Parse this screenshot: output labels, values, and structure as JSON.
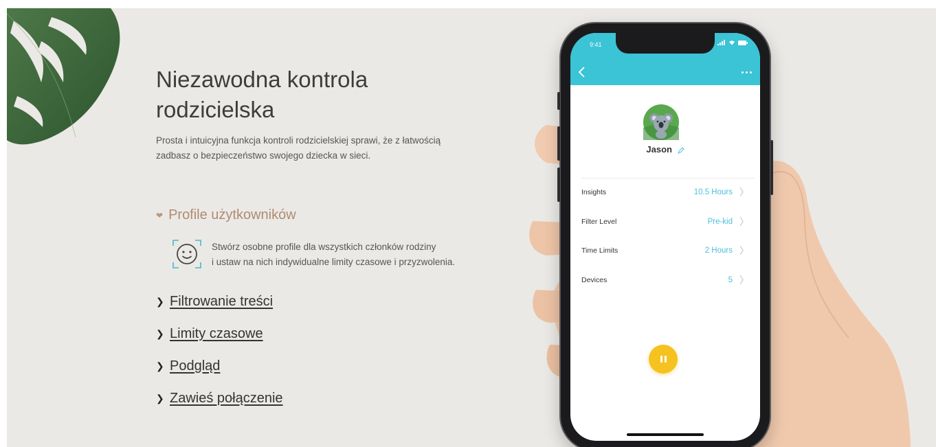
{
  "hero": {
    "title_line1": "Niezawodna kontrola",
    "title_line2": "rodzicielska",
    "subtitle_line1": "Prosta i intuicyjna funkcja kontroli rodzicielskiej sprawi, że z łatwością",
    "subtitle_line2": "zadbasz o bezpieczeństwo swojego dziecka w sieci."
  },
  "features": {
    "open_item": {
      "label": "Profile użytkowników",
      "icon": "smiley-face-icon",
      "desc_line1": "Stwórz osobne profile dla wszystkich członków rodziny",
      "desc_line2": "i ustaw na nich indywidualne limity czasowe i przyzwolenia."
    },
    "items": [
      {
        "label": "Filtrowanie treści"
      },
      {
        "label": "Limity czasowe"
      },
      {
        "label": "Podgląd"
      },
      {
        "label": "Zawieś połączenie"
      }
    ]
  },
  "phone": {
    "status_time": "9:41",
    "profile_name": "Jason",
    "rows": [
      {
        "label": "Insights",
        "value": "10.5 Hours"
      },
      {
        "label": "Filter Level",
        "value": "Pre-kid"
      },
      {
        "label": "Time Limits",
        "value": "2 Hours"
      },
      {
        "label": "Devices",
        "value": "5"
      }
    ]
  },
  "colors": {
    "background": "#ebe9e5",
    "accent_open": "#b08b72",
    "app_header": "#3bc3d6",
    "app_value": "#4bc0db",
    "pause_button": "#f6c21f"
  }
}
